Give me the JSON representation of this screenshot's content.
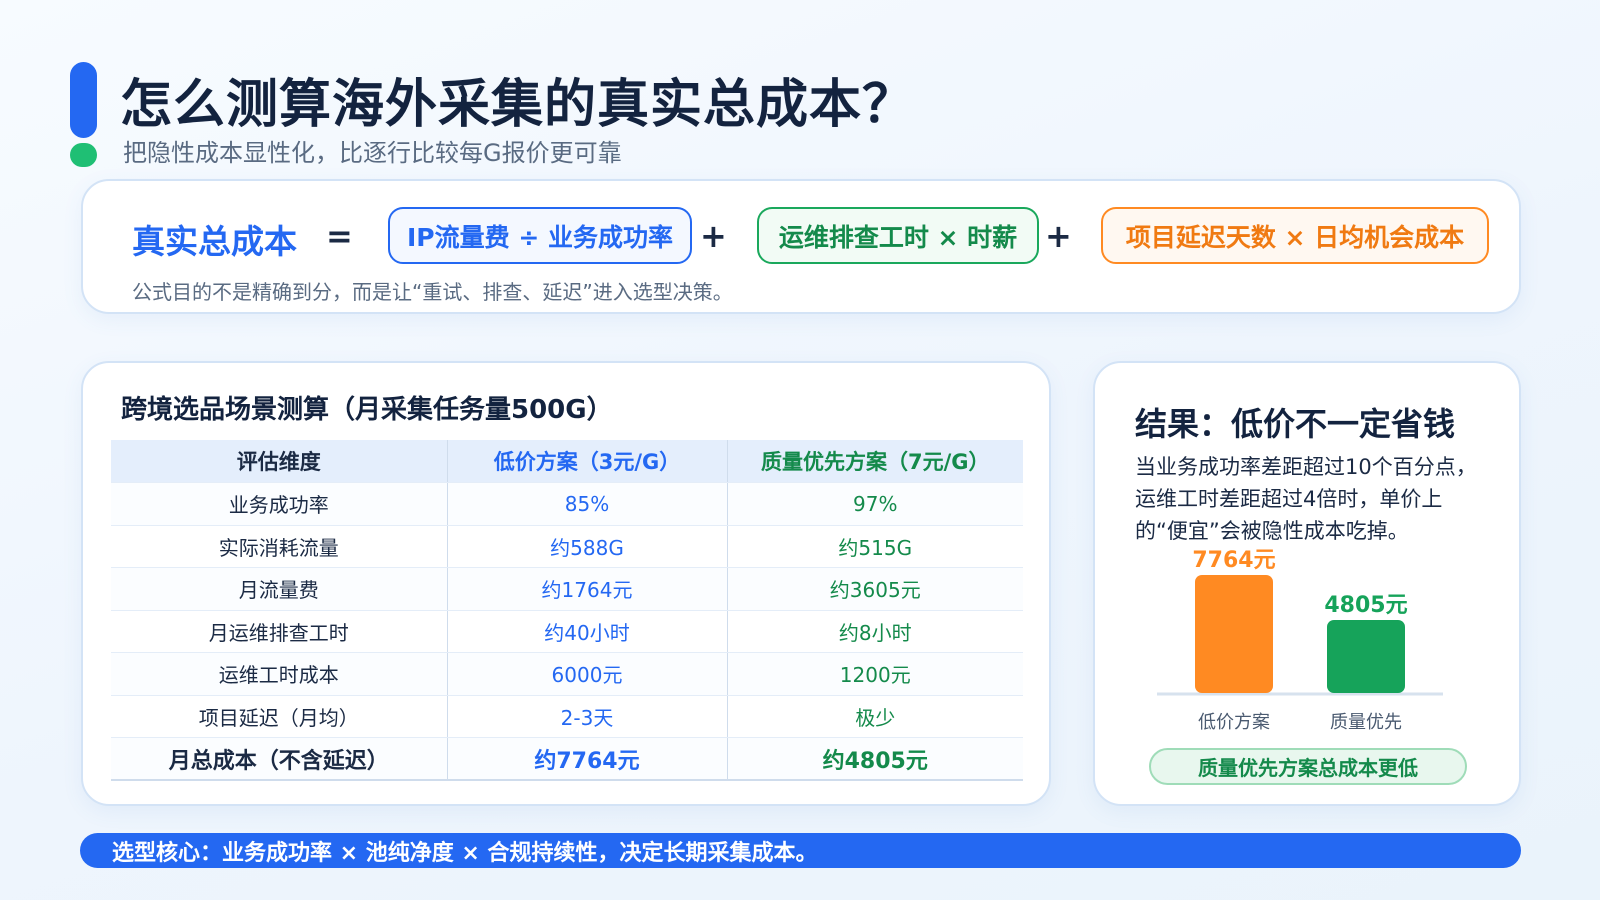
{
  "header": {
    "title": "怎么测算海外采集的真实总成本？",
    "subtitle": "把隐性成本显性化，比逐行比较每G报价更可靠"
  },
  "formula": {
    "label": "真实总成本",
    "equals": "=",
    "plus": "+",
    "term1": "IP流量费 ÷ 业务成功率",
    "term2": "运维排查工时 × 时薪",
    "term3": "项目延迟天数 × 日均机会成本",
    "note": "公式目的不是精确到分，而是让“重试、排查、延迟”进入选型决策。"
  },
  "table": {
    "title": "跨境选品场景测算（月采集任务量500G）",
    "headers": [
      "评估维度",
      "低价方案（3元/G）",
      "质量优先方案（7元/G）"
    ],
    "rows": [
      [
        "业务成功率",
        "85%",
        "97%"
      ],
      [
        "实际消耗流量",
        "约588G",
        "约515G"
      ],
      [
        "月流量费",
        "约1764元",
        "约3605元"
      ],
      [
        "月运维排查工时",
        "约40小时",
        "约8小时"
      ],
      [
        "运维工时成本",
        "6000元",
        "1200元"
      ],
      [
        "项目延迟（月均）",
        "2-3天",
        "极少"
      ],
      [
        "月总成本（不含延迟）",
        "约7764元",
        "约4805元"
      ]
    ]
  },
  "result": {
    "title": "结果：低价不一定省钱",
    "description": "当业务成功率差距超过10个百分点，运维工时差距超过4倍时，单价上的“便宜”会被隐性成本吃掉。",
    "conclusion": "质量优先方案总成本更低"
  },
  "chart_data": {
    "type": "bar",
    "categories": [
      "低价方案",
      "质量优先"
    ],
    "values": [
      7764,
      4805
    ],
    "data_labels": [
      "7764元",
      "4805元"
    ],
    "colors": [
      "#ff8a22",
      "#16a35a"
    ],
    "title": "",
    "xlabel": "",
    "ylabel": "",
    "ylim": [
      0,
      7764
    ],
    "grid": false
  },
  "banner": {
    "text": "选型核心：业务成功率 × 池纯净度 × 合规持续性，决定长期采集成本。"
  }
}
